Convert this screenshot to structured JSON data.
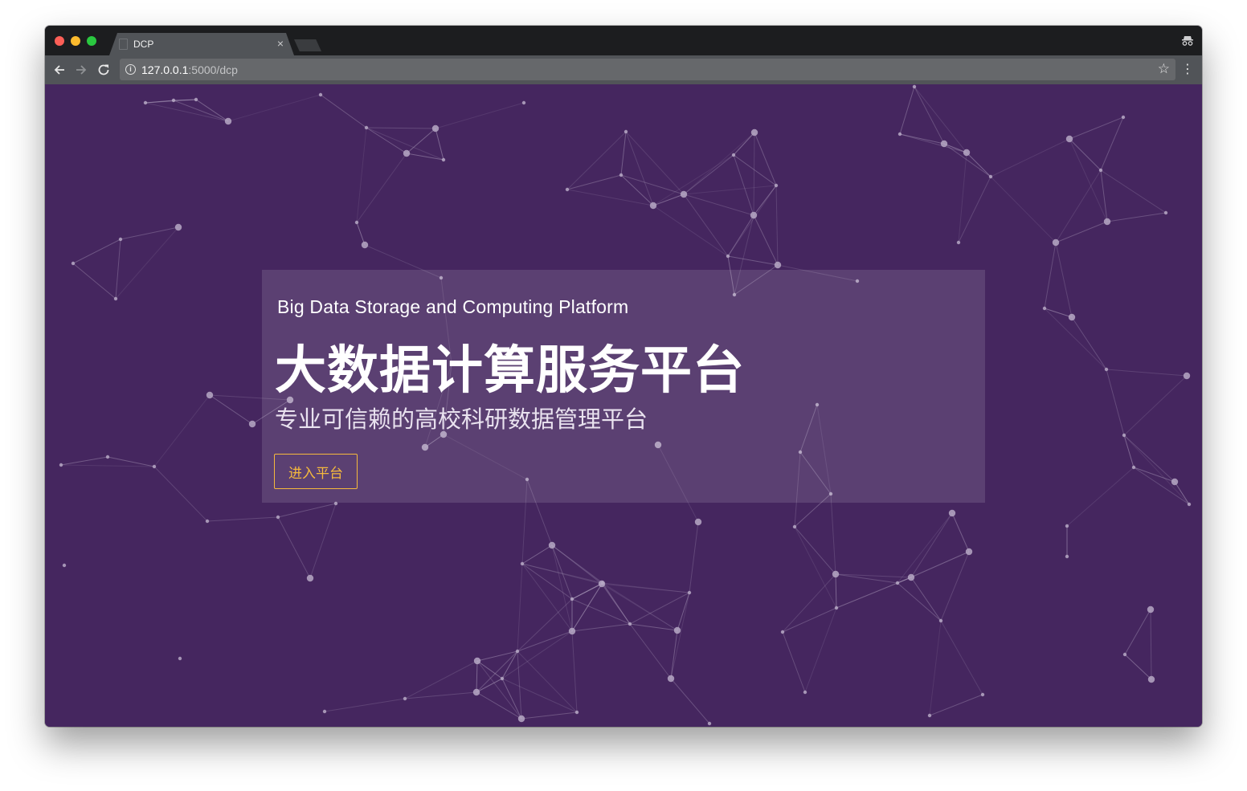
{
  "browser": {
    "tab_title": "DCP",
    "tab_close": "×",
    "url_host": "127.0.0.1",
    "url_rest": ":5000/dcp",
    "icons": {
      "back": "arrow-left-icon",
      "forward": "arrow-right-icon",
      "reload": "reload-icon",
      "site_info": "info-icon",
      "bookmark": "star-icon",
      "menu": "kebab-menu-icon",
      "incognito": "incognito-icon"
    }
  },
  "hero": {
    "subtitle_en": "Big Data Storage and Computing Platform",
    "title": "大数据计算服务平台",
    "tagline": "专业可信赖的高校科研数据管理平台",
    "button_label": "进入平台"
  },
  "theme": {
    "background": "#45265f",
    "accent": "#f5b93d",
    "node_color": "#b6a8c4"
  }
}
